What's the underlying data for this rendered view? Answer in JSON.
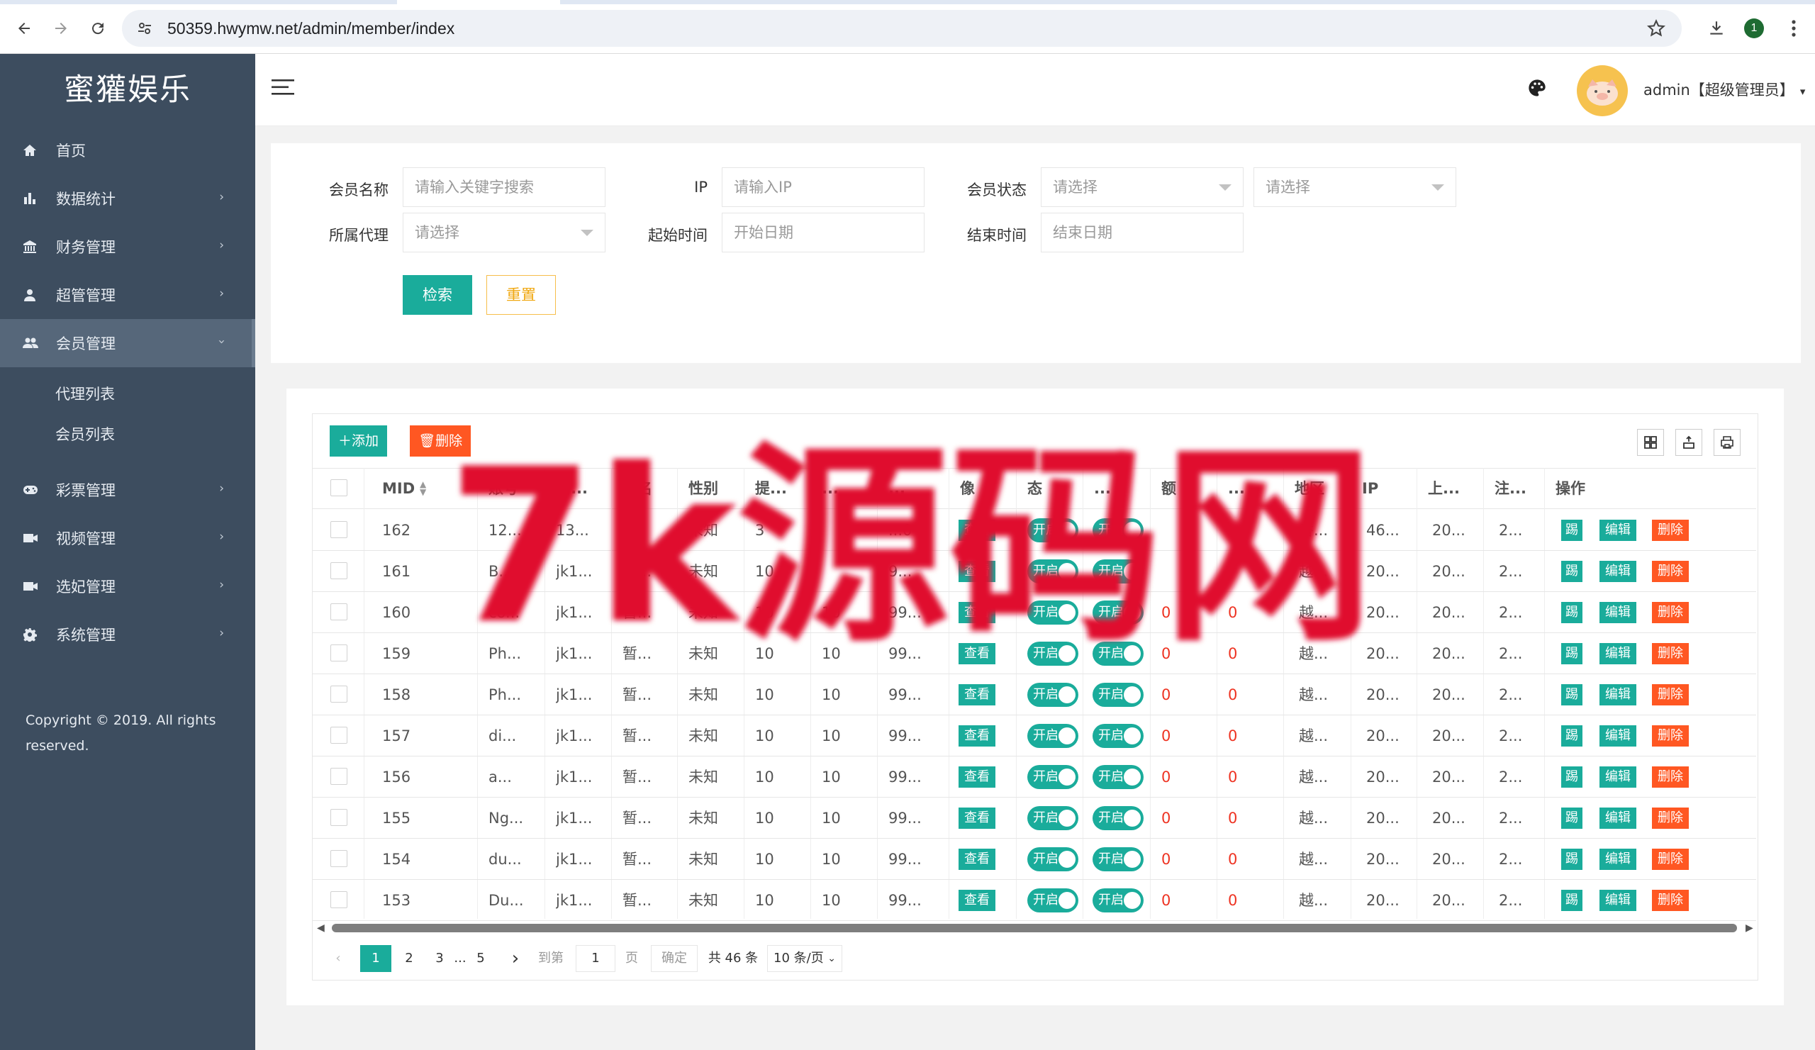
{
  "browser": {
    "url": "50359.hwymw.net/admin/member/index",
    "extension_badge": "1"
  },
  "sidebar": {
    "brand": "蜜獾娱乐",
    "items": [
      {
        "label": "首页",
        "icon": "home-icon",
        "arrow": ""
      },
      {
        "label": "数据统计",
        "icon": "bar-chart-icon",
        "arrow": "›"
      },
      {
        "label": "财务管理",
        "icon": "bank-icon",
        "arrow": "›"
      },
      {
        "label": "超管管理",
        "icon": "user-icon",
        "arrow": "›"
      },
      {
        "label": "会员管理",
        "icon": "users-icon",
        "arrow": "›"
      }
    ],
    "subitems": [
      {
        "label": "代理列表"
      },
      {
        "label": "会员列表"
      }
    ],
    "items2": [
      {
        "label": "彩票管理",
        "icon": "gamepad-icon",
        "arrow": "›"
      },
      {
        "label": "视频管理",
        "icon": "video-icon",
        "arrow": "›"
      },
      {
        "label": "选妃管理",
        "icon": "camera-icon",
        "arrow": "›"
      },
      {
        "label": "系统管理",
        "icon": "gear-icon",
        "arrow": "›"
      }
    ],
    "copyright": "Copyright © 2019. All rights reserved."
  },
  "header": {
    "user": "admin【超级管理员】"
  },
  "search": {
    "name_label": "会员名称",
    "name_placeholder": "请输入关键字搜索",
    "ip_label": "IP",
    "ip_placeholder": "请输入IP",
    "status_label": "会员状态",
    "status_placeholder": "请选择",
    "status2_placeholder": "请选择",
    "agent_label": "所属代理",
    "agent_placeholder": "请选择",
    "start_label": "起始时间",
    "start_placeholder": "开始日期",
    "end_label": "结束时间",
    "end_placeholder": "结束日期",
    "search_btn": "检索",
    "reset_btn": "重置"
  },
  "toolbar": {
    "add": "添加",
    "delete": "删除"
  },
  "table": {
    "headers": [
      "MID",
      "账号",
      "所...",
      "姓名",
      "性别",
      "提...",
      "...",
      "...",
      "像",
      "态",
      "...",
      "额",
      "...",
      "地区",
      "IP",
      "上...",
      "注...",
      "操作"
    ],
    "view_label": "查看",
    "switch_label": "开启",
    "op_labels": [
      "踢",
      "编辑",
      "删除"
    ],
    "rows": [
      {
        "mid": "162",
        "acc": "12...",
        "agent": "13...",
        "name": "",
        "sex": "未知",
        "c5": "3",
        "c6": "",
        "c7": "...0",
        "m1": "",
        "m2": "",
        "region": "香...",
        "ip": "46...",
        "last": "20...",
        "reg": "2..."
      },
      {
        "mid": "161",
        "acc": "B...",
        "agent": "jk1...",
        "name": "暂...",
        "sex": "未知",
        "c5": "10",
        "c6": "",
        "c7": "9...",
        "m1": "",
        "m2": "",
        "region": "越...",
        "ip": "20...",
        "last": "20...",
        "reg": "2..."
      },
      {
        "mid": "160",
        "acc": "co...",
        "agent": "jk1...",
        "name": "暂...",
        "sex": "未知",
        "c5": "10",
        "c6": "10",
        "c7": "99...",
        "m1": "0",
        "m2": "0",
        "region": "越...",
        "ip": "20...",
        "last": "20...",
        "reg": "2..."
      },
      {
        "mid": "159",
        "acc": "Ph...",
        "agent": "jk1...",
        "name": "暂...",
        "sex": "未知",
        "c5": "10",
        "c6": "10",
        "c7": "99...",
        "m1": "0",
        "m2": "0",
        "region": "越...",
        "ip": "20...",
        "last": "20...",
        "reg": "2..."
      },
      {
        "mid": "158",
        "acc": "Ph...",
        "agent": "jk1...",
        "name": "暂...",
        "sex": "未知",
        "c5": "10",
        "c6": "10",
        "c7": "99...",
        "m1": "0",
        "m2": "0",
        "region": "越...",
        "ip": "20...",
        "last": "20...",
        "reg": "2..."
      },
      {
        "mid": "157",
        "acc": "di...",
        "agent": "jk1...",
        "name": "暂...",
        "sex": "未知",
        "c5": "10",
        "c6": "10",
        "c7": "99...",
        "m1": "0",
        "m2": "0",
        "region": "越...",
        "ip": "20...",
        "last": "20...",
        "reg": "2..."
      },
      {
        "mid": "156",
        "acc": "a...",
        "agent": "jk1...",
        "name": "暂...",
        "sex": "未知",
        "c5": "10",
        "c6": "10",
        "c7": "99...",
        "m1": "0",
        "m2": "0",
        "region": "越...",
        "ip": "20...",
        "last": "20...",
        "reg": "2..."
      },
      {
        "mid": "155",
        "acc": "Ng...",
        "agent": "jk1...",
        "name": "暂...",
        "sex": "未知",
        "c5": "10",
        "c6": "10",
        "c7": "99...",
        "m1": "0",
        "m2": "0",
        "region": "越...",
        "ip": "20...",
        "last": "20...",
        "reg": "2..."
      },
      {
        "mid": "154",
        "acc": "du...",
        "agent": "jk1...",
        "name": "暂...",
        "sex": "未知",
        "c5": "10",
        "c6": "10",
        "c7": "99...",
        "m1": "0",
        "m2": "0",
        "region": "越...",
        "ip": "20...",
        "last": "20...",
        "reg": "2..."
      },
      {
        "mid": "153",
        "acc": "Du...",
        "agent": "jk1...",
        "name": "暂...",
        "sex": "未知",
        "c5": "10",
        "c6": "10",
        "c7": "99...",
        "m1": "0",
        "m2": "0",
        "region": "越...",
        "ip": "20...",
        "last": "20...",
        "reg": "2..."
      }
    ]
  },
  "pagination": {
    "prev": "‹",
    "pages": [
      "1",
      "2",
      "3",
      "...",
      "5"
    ],
    "next": "›",
    "goto_label": "到第",
    "goto_value": "1",
    "page_unit": "页",
    "confirm": "确定",
    "total": "共 46 条",
    "per_page": "10 条/页"
  },
  "watermark": {
    "text": "7k源码网",
    "color": "#e0102e"
  },
  "colors": {
    "accent": "#1aac9b",
    "danger": "#ff5722",
    "sidebar": "#3d4d5f"
  }
}
